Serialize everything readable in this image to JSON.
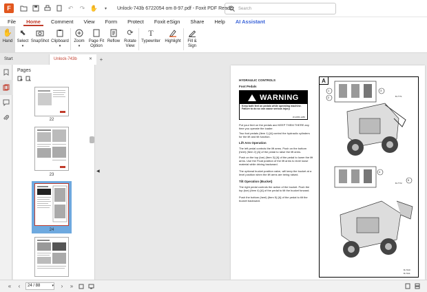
{
  "titlebar": {
    "doc_title": "Unlock-743b 6722054 om 8-97.pdf - Foxit PDF Reader",
    "search_placeholder": "Search"
  },
  "menu": {
    "items": [
      "File",
      "Home",
      "Comment",
      "View",
      "Form",
      "Protect",
      "Foxit eSign",
      "Share",
      "Help",
      "AI Assistant"
    ],
    "active": "Home"
  },
  "ribbon": {
    "hand": "Hand",
    "select": "Select",
    "snapshot": "SnapShot",
    "clipboard": "Clipboard",
    "zoom": "Zoom",
    "page_fit_1": "Page Fit",
    "page_fit_2": "Option",
    "reflow": "Reflow",
    "rotate_1": "Rotate",
    "rotate_2": "View",
    "typewriter": "Typewriter",
    "highlight": "Highlight",
    "fillsign_1": "Fill &",
    "fillsign_2": "Sign"
  },
  "tabs": {
    "start": "Start",
    "doc": "Unlock-743b 672205..."
  },
  "pages_panel": {
    "title": "Pages",
    "thumbs": [
      {
        "label": "22"
      },
      {
        "label": "23"
      },
      {
        "label": "24"
      },
      {
        "label": ""
      }
    ]
  },
  "pdf_page": {
    "heading": "HYDRAULIC CONTROLS",
    "subheading": "Foot Pedals",
    "warning_title": "WARNING",
    "warning_body": "Keep both feet on pedals while operating machine. Failure to do so can cause serious injury.",
    "warning_code": "W-2065-1286",
    "p1": "Put your feet on the pedals and KEEP THEM THERE any time you operate the loader.",
    "p2": "Two foot pedals (Item 1) [A] control the hydraulic cylinders for the lift and tilt function.",
    "lift_head": "Lift Arm Operation",
    "p3": "The left pedal controls the lift arms. Push on the bottom (heel) (Item 2) [A] of the pedal to raise the lift arms.",
    "p4": "Push on the top (toe) (Item 3) [A] of the pedal to lower the lift arms. Use the Float position of the lift arms to level loose material while driving backward.",
    "p5": "The optional bucket position valve, will keep the bucket at a level position when the lift arms are being raised.",
    "tilt_head": "Tilt Operation (Bucket)",
    "p6": "The right pedal controls the action of the bucket. Push the top (toe) (Item 4) [A] of the pedal to tilt the bucket forward.",
    "p7": "Push the bottom (heel) (Item 5) [A] of the pedal to tilt the bucket backward.",
    "fig_tag": "A",
    "fig_callouts": [
      "1",
      "2",
      "3",
      "4",
      "5"
    ],
    "fig_codes": [
      "B-7771",
      "B-7772",
      "B-7440",
      "B-7441"
    ]
  },
  "status": {
    "page_value": "24 / 88"
  }
}
